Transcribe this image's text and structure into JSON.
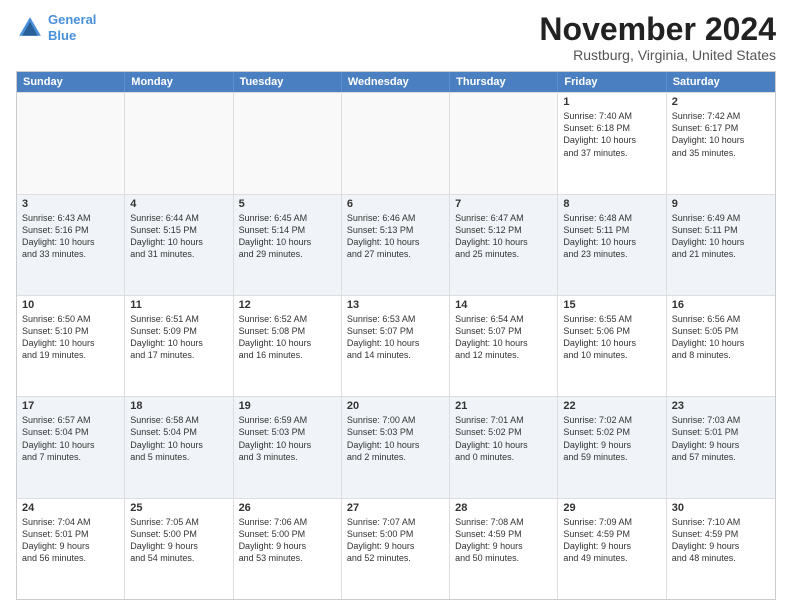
{
  "header": {
    "logo_line1": "General",
    "logo_line2": "Blue",
    "month": "November 2024",
    "location": "Rustburg, Virginia, United States"
  },
  "weekdays": [
    "Sunday",
    "Monday",
    "Tuesday",
    "Wednesday",
    "Thursday",
    "Friday",
    "Saturday"
  ],
  "rows": [
    {
      "alt": false,
      "cells": [
        {
          "day": "",
          "info": ""
        },
        {
          "day": "",
          "info": ""
        },
        {
          "day": "",
          "info": ""
        },
        {
          "day": "",
          "info": ""
        },
        {
          "day": "",
          "info": ""
        },
        {
          "day": "1",
          "info": "Sunrise: 7:40 AM\nSunset: 6:18 PM\nDaylight: 10 hours\nand 37 minutes."
        },
        {
          "day": "2",
          "info": "Sunrise: 7:42 AM\nSunset: 6:17 PM\nDaylight: 10 hours\nand 35 minutes."
        }
      ]
    },
    {
      "alt": true,
      "cells": [
        {
          "day": "3",
          "info": "Sunrise: 6:43 AM\nSunset: 5:16 PM\nDaylight: 10 hours\nand 33 minutes."
        },
        {
          "day": "4",
          "info": "Sunrise: 6:44 AM\nSunset: 5:15 PM\nDaylight: 10 hours\nand 31 minutes."
        },
        {
          "day": "5",
          "info": "Sunrise: 6:45 AM\nSunset: 5:14 PM\nDaylight: 10 hours\nand 29 minutes."
        },
        {
          "day": "6",
          "info": "Sunrise: 6:46 AM\nSunset: 5:13 PM\nDaylight: 10 hours\nand 27 minutes."
        },
        {
          "day": "7",
          "info": "Sunrise: 6:47 AM\nSunset: 5:12 PM\nDaylight: 10 hours\nand 25 minutes."
        },
        {
          "day": "8",
          "info": "Sunrise: 6:48 AM\nSunset: 5:11 PM\nDaylight: 10 hours\nand 23 minutes."
        },
        {
          "day": "9",
          "info": "Sunrise: 6:49 AM\nSunset: 5:11 PM\nDaylight: 10 hours\nand 21 minutes."
        }
      ]
    },
    {
      "alt": false,
      "cells": [
        {
          "day": "10",
          "info": "Sunrise: 6:50 AM\nSunset: 5:10 PM\nDaylight: 10 hours\nand 19 minutes."
        },
        {
          "day": "11",
          "info": "Sunrise: 6:51 AM\nSunset: 5:09 PM\nDaylight: 10 hours\nand 17 minutes."
        },
        {
          "day": "12",
          "info": "Sunrise: 6:52 AM\nSunset: 5:08 PM\nDaylight: 10 hours\nand 16 minutes."
        },
        {
          "day": "13",
          "info": "Sunrise: 6:53 AM\nSunset: 5:07 PM\nDaylight: 10 hours\nand 14 minutes."
        },
        {
          "day": "14",
          "info": "Sunrise: 6:54 AM\nSunset: 5:07 PM\nDaylight: 10 hours\nand 12 minutes."
        },
        {
          "day": "15",
          "info": "Sunrise: 6:55 AM\nSunset: 5:06 PM\nDaylight: 10 hours\nand 10 minutes."
        },
        {
          "day": "16",
          "info": "Sunrise: 6:56 AM\nSunset: 5:05 PM\nDaylight: 10 hours\nand 8 minutes."
        }
      ]
    },
    {
      "alt": true,
      "cells": [
        {
          "day": "17",
          "info": "Sunrise: 6:57 AM\nSunset: 5:04 PM\nDaylight: 10 hours\nand 7 minutes."
        },
        {
          "day": "18",
          "info": "Sunrise: 6:58 AM\nSunset: 5:04 PM\nDaylight: 10 hours\nand 5 minutes."
        },
        {
          "day": "19",
          "info": "Sunrise: 6:59 AM\nSunset: 5:03 PM\nDaylight: 10 hours\nand 3 minutes."
        },
        {
          "day": "20",
          "info": "Sunrise: 7:00 AM\nSunset: 5:03 PM\nDaylight: 10 hours\nand 2 minutes."
        },
        {
          "day": "21",
          "info": "Sunrise: 7:01 AM\nSunset: 5:02 PM\nDaylight: 10 hours\nand 0 minutes."
        },
        {
          "day": "22",
          "info": "Sunrise: 7:02 AM\nSunset: 5:02 PM\nDaylight: 9 hours\nand 59 minutes."
        },
        {
          "day": "23",
          "info": "Sunrise: 7:03 AM\nSunset: 5:01 PM\nDaylight: 9 hours\nand 57 minutes."
        }
      ]
    },
    {
      "alt": false,
      "cells": [
        {
          "day": "24",
          "info": "Sunrise: 7:04 AM\nSunset: 5:01 PM\nDaylight: 9 hours\nand 56 minutes."
        },
        {
          "day": "25",
          "info": "Sunrise: 7:05 AM\nSunset: 5:00 PM\nDaylight: 9 hours\nand 54 minutes."
        },
        {
          "day": "26",
          "info": "Sunrise: 7:06 AM\nSunset: 5:00 PM\nDaylight: 9 hours\nand 53 minutes."
        },
        {
          "day": "27",
          "info": "Sunrise: 7:07 AM\nSunset: 5:00 PM\nDaylight: 9 hours\nand 52 minutes."
        },
        {
          "day": "28",
          "info": "Sunrise: 7:08 AM\nSunset: 4:59 PM\nDaylight: 9 hours\nand 50 minutes."
        },
        {
          "day": "29",
          "info": "Sunrise: 7:09 AM\nSunset: 4:59 PM\nDaylight: 9 hours\nand 49 minutes."
        },
        {
          "day": "30",
          "info": "Sunrise: 7:10 AM\nSunset: 4:59 PM\nDaylight: 9 hours\nand 48 minutes."
        }
      ]
    }
  ]
}
